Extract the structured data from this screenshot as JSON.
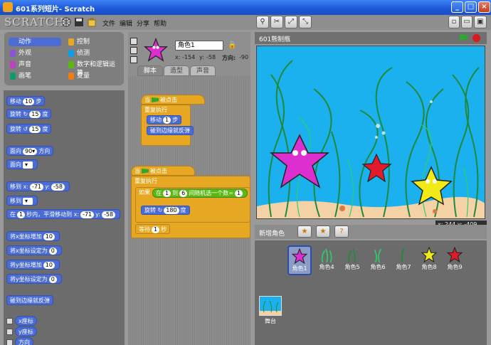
{
  "window": {
    "title": "601系列短片- Scratch"
  },
  "menu": {
    "logo": "SCRATCH",
    "items": [
      "文件",
      "编辑",
      "分享",
      "帮助"
    ]
  },
  "categories": [
    {
      "label": "动作",
      "color": "#4a6cd4"
    },
    {
      "label": "控制",
      "color": "#e6a822"
    },
    {
      "label": "外观",
      "color": "#8a55d7"
    },
    {
      "label": "侦测",
      "color": "#0e9ee5"
    },
    {
      "label": "声音",
      "color": "#bb42c3"
    },
    {
      "label": "数字和逻辑运算",
      "color": "#5cb712"
    },
    {
      "label": "画笔",
      "color": "#0e9a6c"
    },
    {
      "label": "变量",
      "color": "#ee7d16"
    }
  ],
  "palette": {
    "move": {
      "a": "移动",
      "v": "10",
      "b": "步"
    },
    "turn_cw": {
      "a": "旋转",
      "v": "15",
      "b": "度"
    },
    "turn_ccw": {
      "a": "旋转",
      "v": "15",
      "b": "度"
    },
    "point_dir": {
      "a": "面向",
      "v": "90▾",
      "b": "方向"
    },
    "point_towards": {
      "a": "面向"
    },
    "goto_xy": {
      "a": "移到 x:",
      "x": "-71",
      "y_label": "y:",
      "y": "-58"
    },
    "goto": {
      "a": "移到"
    },
    "glide": {
      "a": "在",
      "v": "1",
      "b": "秒内，平滑移动到 x:",
      "x": "-71",
      "y_label": "y:",
      "y": "-58"
    },
    "change_x": {
      "a": "将x坐标增加",
      "v": "10"
    },
    "set_x": {
      "a": "将x坐标设定为",
      "v": "0"
    },
    "change_y": {
      "a": "将y坐标增加",
      "v": "10"
    },
    "set_y": {
      "a": "将y坐标设定为",
      "v": "0"
    },
    "bounce": "碰到边缘就反弹",
    "xpos": "x座标",
    "ypos": "y座标",
    "direction": "方向"
  },
  "sprite": {
    "name": "角色1",
    "x_label": "x:",
    "x": "-154",
    "y_label": "y:",
    "y": "-58",
    "dir_label": "方向:",
    "dir": "-90"
  },
  "tabs": [
    "脚本",
    "造型",
    "声音"
  ],
  "script1": {
    "hat_a": "当",
    "hat_b": "被点击",
    "forever": "重复执行",
    "move_a": "移动",
    "move_v": "1",
    "move_b": "步",
    "bounce": "碰到边缘就反弹"
  },
  "script2": {
    "hat_a": "当",
    "hat_b": "被点击",
    "forever": "重复执行",
    "if": "如果",
    "eq_a": "在",
    "eq_v1": "1",
    "eq_b": "到",
    "eq_v2": "6",
    "eq_c": "间随机选一个数",
    "eq_op": "=",
    "eq_v3": "1",
    "turn_a": "旋转",
    "turn_v": "180",
    "turn_b": "度",
    "wait_a": "等待",
    "wait_v": "1",
    "wait_b": "秒"
  },
  "stage": {
    "title": "601熊制瓶",
    "x_label": "x:",
    "x": "244",
    "y_label": "y:",
    "y": "-409"
  },
  "sprite_list": {
    "new_sprite": "新增角色",
    "sprites": [
      "角色1",
      "角色4",
      "角色5",
      "角色6",
      "角色7",
      "角色8",
      "角色9"
    ],
    "stage_label": "舞台"
  },
  "colors": {
    "motion": "#4a6cd4",
    "control": "#e6a822",
    "operators": "#5cb712",
    "stage_water": "#1bb1ee"
  }
}
